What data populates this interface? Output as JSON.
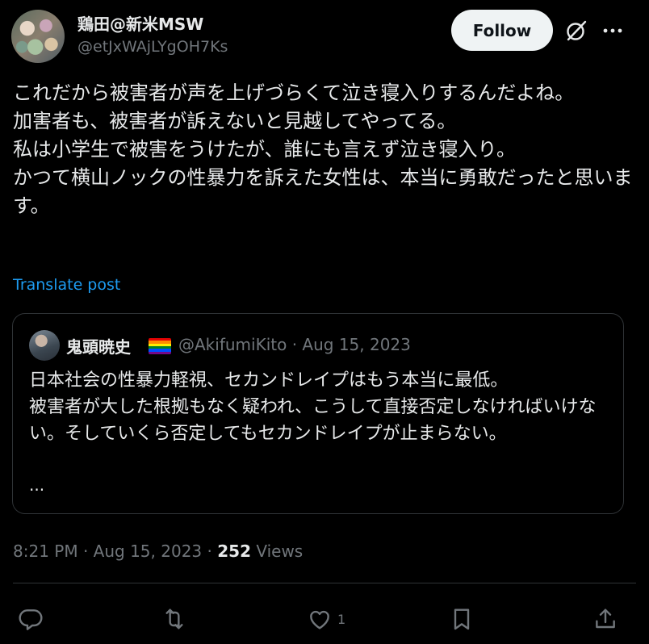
{
  "author": {
    "display_name": "鶏田@新米MSW",
    "handle": "@etJxWAjLYgOH7Ks",
    "follow_label": "Follow"
  },
  "post": {
    "text": "これだから被害者が声を上げづらくて泣き寝入りするんだよね。\n加害者も、被害者が訴えないと見越してやってる。\n私は小学生で被害をうけたが、誰にも言えず泣き寝入り。\nかつて横山ノックの性暴力を訴えた女性は、本当に勇敢だったと思います。",
    "translate_label": "Translate post"
  },
  "quote": {
    "display_name": "鬼頭暁史",
    "handle": "@AkifumiKito",
    "separator": "·",
    "date": "Aug 15, 2023",
    "text": "日本社会の性暴力軽視、セカンドレイプはもう本当に最低。\n被害者が大した根拠もなく疑われ、こうして直接否定しなければいけない。そしていくら否定してもセカンドレイプが止まらない。",
    "ellipsis": "..."
  },
  "meta": {
    "time": "8:21 PM",
    "separator": "·",
    "date": "Aug 15, 2023",
    "separator2": "·",
    "views_count": "252",
    "views_label": "Views"
  },
  "actions": {
    "reply_icon": "reply-icon",
    "repost_icon": "repost-icon",
    "like_icon": "heart-icon",
    "like_count": "1",
    "bookmark_icon": "bookmark-icon",
    "share_icon": "share-icon"
  },
  "colors": {
    "background": "#000000",
    "text": "#e7e9ea",
    "secondary": "#71767b",
    "link": "#1d9bf0",
    "border": "#2f3336",
    "follow_bg": "#eff3f4"
  }
}
